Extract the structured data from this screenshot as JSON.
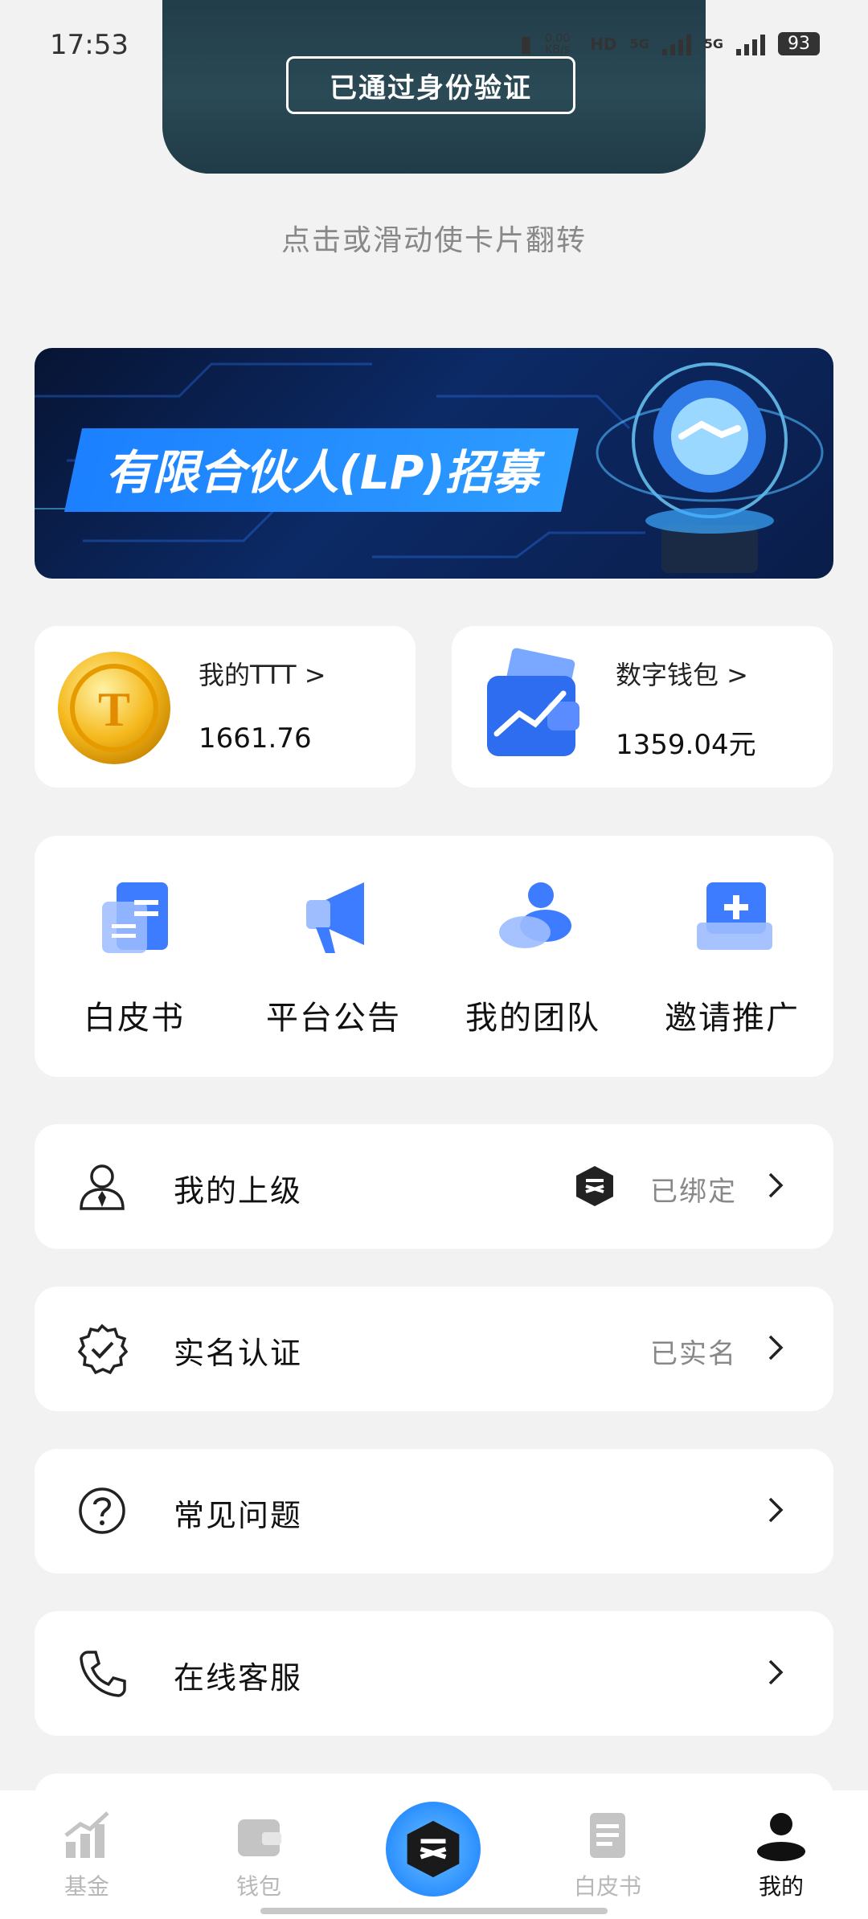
{
  "status_bar": {
    "time": "17:53",
    "speed": "0.00 KB/s",
    "network1": "5G",
    "network2": "5G",
    "battery": "93"
  },
  "id_card": {
    "verified_label": "已通过身份验证",
    "flip_hint": "点击或滑动使卡片翻转"
  },
  "banner": {
    "title": "有限合伙人(LP)招募"
  },
  "assets": [
    {
      "label": "我的TTT >",
      "value": "1661.76",
      "icon": "gold-coin-icon"
    },
    {
      "label": "数字钱包 >",
      "value": "1359.04元",
      "icon": "wallet-icon"
    }
  ],
  "quick_actions": [
    {
      "label": "白皮书",
      "icon": "document-icon"
    },
    {
      "label": "平台公告",
      "icon": "megaphone-icon"
    },
    {
      "label": "我的团队",
      "icon": "team-icon"
    },
    {
      "label": "邀请推广",
      "icon": "invite-icon"
    }
  ],
  "menu": [
    {
      "label": "我的上级",
      "status": "已绑定",
      "icon": "person-icon"
    },
    {
      "label": "实名认证",
      "status": "已实名",
      "icon": "verified-badge-icon"
    },
    {
      "label": "常见问题",
      "status": "",
      "icon": "question-icon"
    },
    {
      "label": "在线客服",
      "status": "",
      "icon": "phone-icon"
    }
  ],
  "bottom_nav": [
    {
      "label": "基金",
      "icon": "chart-icon",
      "active": false
    },
    {
      "label": "钱包",
      "icon": "wallet-icon",
      "active": false
    },
    {
      "label": "",
      "icon": "app-logo-icon",
      "active": false
    },
    {
      "label": "白皮书",
      "icon": "document-icon",
      "active": false
    },
    {
      "label": "我的",
      "icon": "user-icon",
      "active": true
    }
  ],
  "colors": {
    "accent_blue": "#2d8cff",
    "card_dark": "#203a46",
    "inactive_nav": "#b8b8b8"
  }
}
